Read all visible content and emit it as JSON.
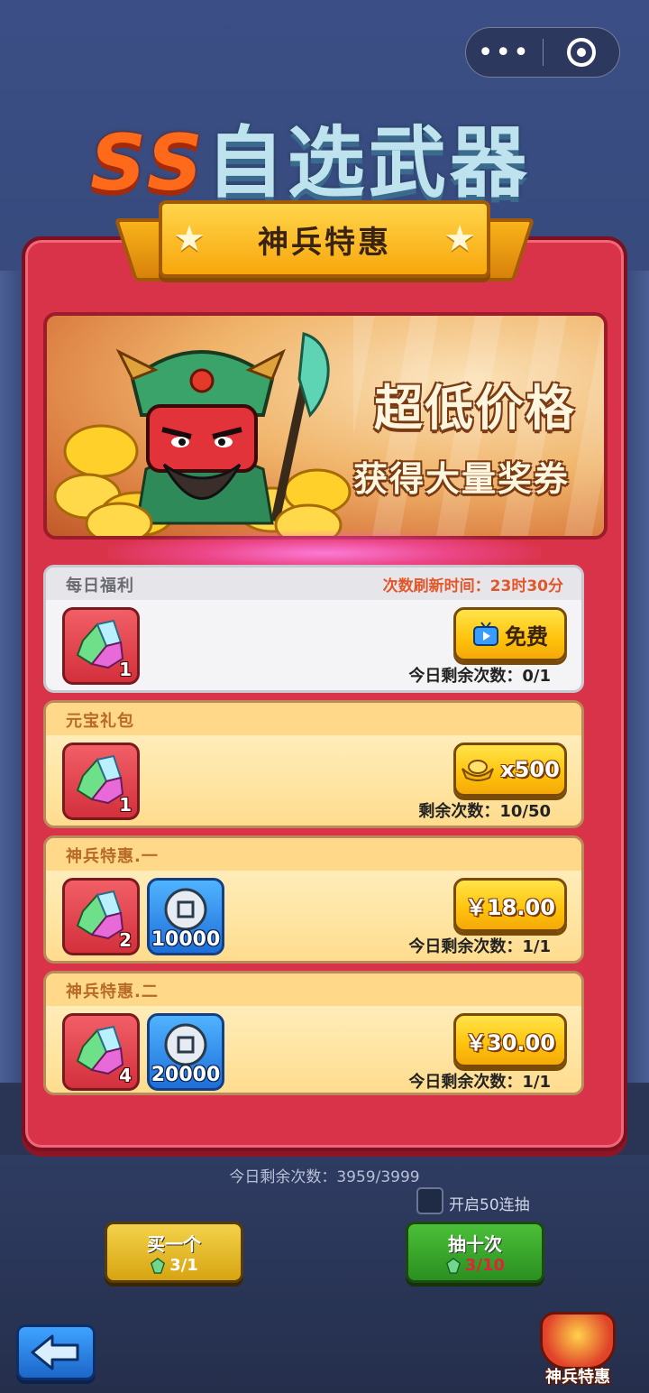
{
  "capsule": {
    "more_icon": "more-dots-icon",
    "close_icon": "target-circle-icon"
  },
  "background_title": {
    "prefix": "SS",
    "text": "自选武器"
  },
  "popup": {
    "title": "神兵特惠",
    "banner": {
      "line1": "超低价格",
      "line2": "获得大量奖券"
    },
    "cards": [
      {
        "name": "每日福利",
        "refresh_text": "次数刷新时间：23时30分",
        "items": [
          {
            "type": "gem",
            "count": "1"
          }
        ],
        "button_label": "免费",
        "button_icon": "tv-video-icon",
        "remaining": "今日剩余次数：0/1"
      },
      {
        "name": "元宝礼包",
        "items": [
          {
            "type": "gem",
            "count": "1"
          }
        ],
        "button_label": "x500",
        "button_icon": "gold-ingot-icon",
        "remaining": "剩余次数：10/50"
      },
      {
        "name": "神兵特惠.一",
        "items": [
          {
            "type": "gem",
            "count": "2"
          },
          {
            "type": "coin",
            "count": "10000"
          }
        ],
        "button_label": "￥18.00",
        "remaining": "今日剩余次数：1/1"
      },
      {
        "name": "神兵特惠.二",
        "items": [
          {
            "type": "gem",
            "count": "4"
          },
          {
            "type": "coin",
            "count": "20000"
          }
        ],
        "button_label": "￥30.00",
        "remaining": "今日剩余次数：1/1"
      }
    ]
  },
  "bottom": {
    "remaining": "今日剩余次数：3959/3999",
    "checkbox_label": "开启50连抽",
    "buy_one": {
      "label": "买一个",
      "cost": "3/1"
    },
    "draw_ten": {
      "label": "抽十次",
      "cost": "3/10"
    },
    "promo_label": "神兵特惠"
  },
  "colors": {
    "panel": "#d9334a",
    "ribbon": "#ffc20a",
    "price_button": "#ffc20a",
    "refresh_text": "#e2572a"
  }
}
